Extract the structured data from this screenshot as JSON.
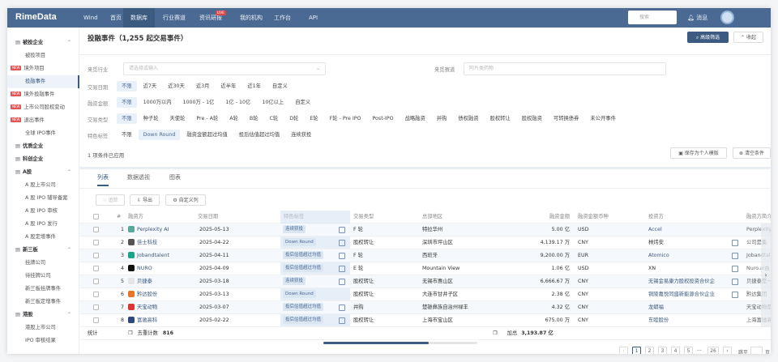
{
  "nav": {
    "logo": "RimeData",
    "items": [
      "Wind",
      "首页",
      "数据库",
      "行业赛道",
      "资讯研报",
      "我的机构",
      "工作台",
      "API"
    ],
    "live": "LIVE",
    "search_placeholder": "搜索",
    "messages": "消息"
  },
  "sidebar": [
    {
      "label": "被投企业",
      "type": "grp"
    },
    {
      "label": "被投项目",
      "type": "sub"
    },
    {
      "label": "境外项目",
      "type": "sub",
      "new": true
    },
    {
      "label": "投融事件",
      "type": "sub",
      "active": true
    },
    {
      "label": "境外投融事件",
      "type": "sub",
      "new": true
    },
    {
      "label": "上市公司股权变动",
      "type": "sub",
      "new": true
    },
    {
      "label": "退出事件",
      "type": "sub",
      "new": true
    },
    {
      "label": "全球 IPO事件",
      "type": "sub"
    },
    {
      "label": "优质企业",
      "type": "grp"
    },
    {
      "label": "科创企业",
      "type": "grp"
    },
    {
      "label": "A股",
      "type": "grp"
    },
    {
      "label": "A 股上市公司",
      "type": "sub"
    },
    {
      "label": "A 股 IPO 辅导备案",
      "type": "sub"
    },
    {
      "label": "A 股 IPO 审核",
      "type": "sub"
    },
    {
      "label": "A 股 IPO 发行",
      "type": "sub"
    },
    {
      "label": "A 股定增事件",
      "type": "sub"
    },
    {
      "label": "新三板",
      "type": "grp"
    },
    {
      "label": "挂牌公司",
      "type": "sub"
    },
    {
      "label": "待挂牌公司",
      "type": "sub"
    },
    {
      "label": "新三板挂牌事件",
      "type": "sub"
    },
    {
      "label": "新三板定增事件",
      "type": "sub"
    },
    {
      "label": "港股",
      "type": "grp"
    },
    {
      "label": "港股上市公司",
      "type": "sub"
    },
    {
      "label": "IPO 审核结果",
      "type": "sub"
    }
  ],
  "new_badge": "NEW",
  "header": {
    "title": "投融事件（1,255 起交易事件）",
    "advanced_filter": "高级筛选",
    "collapse": "收起"
  },
  "filters": {
    "industry": {
      "label": "来觅行业",
      "placeholder": "请选择或输入"
    },
    "track": {
      "label": "来觅赛道",
      "placeholder": "阿片类药物"
    },
    "rows": [
      {
        "label": "交易日期",
        "options": [
          "不限",
          "近7天",
          "近30天",
          "近3月",
          "近半年",
          "近1年",
          "自定义"
        ],
        "selected": 0
      },
      {
        "label": "融资金额",
        "options": [
          "不限",
          "1000万以内",
          "1000万 - 1亿",
          "1亿 - 10亿",
          "10亿以上",
          "自定义"
        ],
        "selected": 0
      },
      {
        "label": "交易类型",
        "options": [
          "不限",
          "种子轮",
          "天使轮",
          "Pre - A轮",
          "A轮",
          "B轮",
          "C轮",
          "D轮",
          "E轮",
          "F轮 - Pre IPO",
          "Post-IPO",
          "战略融资",
          "并购",
          "债权融资",
          "股权转让",
          "股权融资",
          "可转换债券",
          "未公开事件"
        ],
        "selected": 0
      },
      {
        "label": "特色标签",
        "options": [
          "不限",
          "Down Round",
          "融资金额超过均值",
          "投后估值超过均值",
          "连续获投"
        ],
        "selected": 1
      }
    ],
    "applied": "1 项条件已应用",
    "save_template": "保存为个人模版",
    "clear": "清空条件"
  },
  "tabs": [
    "列表",
    "数据透视",
    "图表"
  ],
  "toolbar": {
    "track": "追踪",
    "export": "导出",
    "custom_columns": "自定义列"
  },
  "table": {
    "columns": [
      "#",
      "融资方",
      "交易日期",
      "特色标签",
      "交易类型",
      "总部地区",
      "融资金额",
      "融资金额币种",
      "投资方",
      "融资方简介"
    ],
    "rows": [
      {
        "n": "1",
        "company": "Perplexity AI",
        "date": "2025-05-13",
        "tag": "连续获投",
        "type": "F 轮",
        "hq": "特拉华州",
        "amount": "5.00 亿",
        "cur": "USD",
        "investor": "Accel",
        "inv_link": true,
        "intro": "Perplexity",
        "logo": "#5aa89a"
      },
      {
        "n": "2",
        "company": "佳士科技",
        "date": "2025-04-22",
        "tag": "Down Round",
        "type": "股权转让",
        "hq": "深圳市坪山区",
        "amount": "4,139.17 万",
        "cur": "CNY",
        "investor": "林炜安",
        "inv_link": false,
        "intro": "公司是集",
        "logo": "#555"
      },
      {
        "n": "3",
        "company": "Jobandtalent",
        "date": "2025-04-11",
        "tag": "投后估值超过均值",
        "type": "F 轮",
        "hq": "西班牙",
        "amount": "9,200.00 万",
        "cur": "EUR",
        "investor": "Atomico",
        "inv_link": true,
        "intro": "Jobandtale",
        "logo": "#1aa58a"
      },
      {
        "n": "4",
        "company": "NURO",
        "date": "2025-04-09",
        "tag": "投后估值超过均值",
        "type": "E 轮",
        "hq": "Mountain View",
        "amount": "1.06 亿",
        "cur": "USD",
        "investor": "XN",
        "inv_link": false,
        "intro": "Nuro.ai由",
        "logo": "#111"
      },
      {
        "n": "5",
        "company": "贝捷泰",
        "date": "2025-03-18",
        "tag": "连续获投",
        "type": "股权转让",
        "hq": "无锡市惠山区",
        "amount": "6,666.67 万",
        "cur": "CNY",
        "investor": "无锡金易康力股权投资合伙企",
        "inv_link": true,
        "intro": "贝捷泰是一",
        "logo": "#e5e5e5"
      },
      {
        "n": "6",
        "company": "黔达股份",
        "date": "2025-03-13",
        "tag": "Down Round",
        "type": "股权转让",
        "hq": "大连市甘井子区",
        "amount": "2.38 亿",
        "cur": "CNY",
        "investor": "铜陵嘉悦同盛新能源合伙企业",
        "inv_link": true,
        "intro": "黔达集团",
        "logo": "#e8742a"
      },
      {
        "n": "7",
        "company": "天宝动物",
        "date": "2025-03-07",
        "tag": "投后估值超过均值",
        "type": "并购",
        "hq": "楚雄彝族自治州禄丰",
        "amount": "4.32 亿",
        "cur": "CNY",
        "investor": "龙蟒福",
        "inv_link": true,
        "intro": "天宝动物是",
        "logo": "#d33"
      },
      {
        "n": "8",
        "company": "富驰高科",
        "date": "2025-02-22",
        "tag": "投后估值超过均值",
        "type": "股权转让",
        "hq": "上海市宝山区",
        "amount": "675.00 万",
        "cur": "CNY",
        "investor": "东睦股份",
        "inv_link": true,
        "intro": "上海富驰高",
        "logo": "#2c4a80"
      }
    ],
    "stats": {
      "label": "统计",
      "dedupe": "去重计数",
      "dedupe_value": "816",
      "sum": "加总",
      "sum_value": "3,193.87 亿"
    }
  },
  "pagination": {
    "pages": [
      "1",
      "2",
      "3",
      "4",
      "5",
      "26"
    ],
    "current": "1",
    "ellipsis": "···",
    "jump": "跳至",
    "page_unit": "页"
  }
}
